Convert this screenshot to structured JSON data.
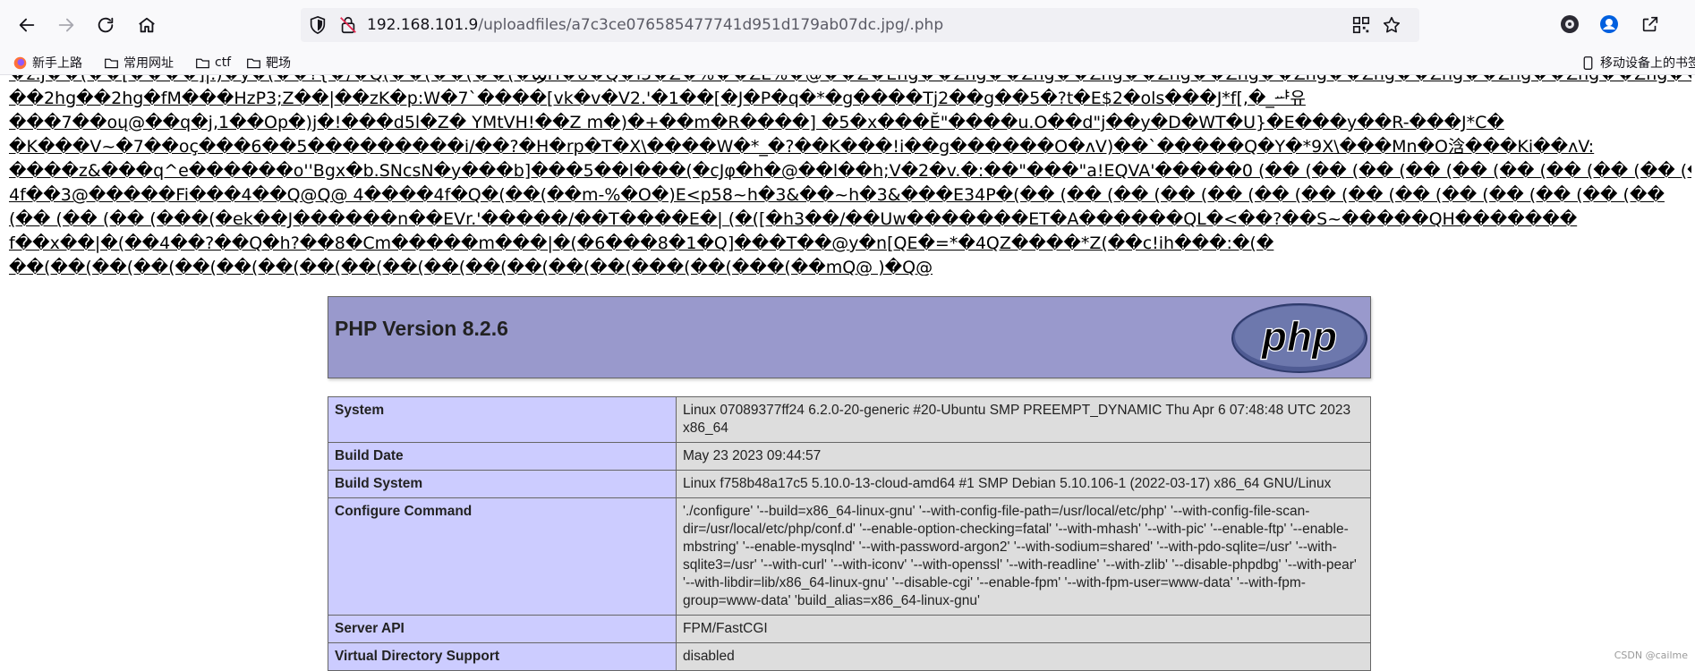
{
  "browser": {
    "url_host": "192.168.101.9",
    "url_path": "/uploadfiles/a7c3ce076585477741d951d179ab07dc.jpg/.php",
    "icons": {
      "back": "arrow-left-icon",
      "forward": "arrow-right-icon",
      "reload": "reload-icon",
      "home": "home-icon",
      "tracking": "shield-icon",
      "insecure": "insecure-lock-icon",
      "qr": "qr-code-icon",
      "bookmark": "star-icon",
      "extension": "extension-icon",
      "account": "account-icon",
      "share": "share-icon"
    }
  },
  "bookmarks": {
    "items": [
      {
        "label": "新手上路",
        "icon": "firefox-icon"
      },
      {
        "label": "常用网址",
        "icon": "folder-icon"
      },
      {
        "label": "ctf",
        "icon": "folder-icon"
      },
      {
        "label": "靶场",
        "icon": "folder-icon"
      }
    ],
    "mobile": "移动设备上的书签"
  },
  "garbage": [
    "�z.j��(��[����]|.)�y�(��?{�/�Q(��(��(��(�ϢH�ö�Q�i5�Z�%��ZE%�@��Z�Eng��Zng��Zng��Zng��Zng��Zng��Zng��Zng��Zng��Zng��Zng��Zng��Zng��Zng��Zng��Zng��Zng",
    "��2hg��2hg�fM���HzP3;Z��|��zK�p:W�7`����[vk�v�V2.'�1��[�J�P�q�*�g����Tj2��g��5�?t�E$2�ols���J*f[,�_ᆄ유",
    "���7��oų@��q�j,1��Op�)j�!���d5l�Z� YMtVH!��Z m�)�+��m�R����] �5�x���Ĕ\"����u.O��d\"j��y�D�WT�U}�E���y��R-���J*C�",
    "�K���V~�7��oç���6��5���������i/��?�H�rp�T�X\\����W�*_�?��K���!i��g������O�ʌV)��`�����Q�Y�*9X\\���Mn�O浛���Ki��ʌV:",
    "����z&���q^e������o''Bgx�b.SNcsN�y���b]���5��l���(�cJφ�h�@��l��h;V�2�v.�:��\"���\"a!EQVA'�����0 (�� (�� (�� (�� (�� (�� (�� (�� (�� (��",
    "4f��3@�����Fi���4��Q@Q@ 4����4f�Q�(��(��m-%�O�)E<p58~h�3&��~h�3&���E34P�(�� (�� (�� (�� (�� (�� (�� (�� (�� (�� (�� (�� (�� (��",
    "(�� (�� (�� (���(�ek��J������n��EVr.'�����/��T����E�| (�([�h3��/��Uw�������ET�A������QL�<��?��S~�����QH�������",
    "f��x��|�(��4��?��Q�h?��8�Cm�����m���|�(�6���8�1�Q]���T��@y�n[QE�=*�4QZ����*Z(��c!ih���:�(�",
    "��(��(��(��(��(��(��(��(��(��(��(��(��(��(��(���(��(���(��mQ@ )�Q@"
  ],
  "php": {
    "title": "PHP Version 8.2.6",
    "logo_text": "php",
    "rows": [
      {
        "key": "System",
        "value": "Linux 07089377ff24 6.2.0-20-generic #20-Ubuntu SMP PREEMPT_DYNAMIC Thu Apr 6 07:48:48 UTC 2023 x86_64"
      },
      {
        "key": "Build Date",
        "value": "May 23 2023 09:44:57"
      },
      {
        "key": "Build System",
        "value": "Linux f758b48a17c5 5.10.0-13-cloud-amd64 #1 SMP Debian 5.10.106-1 (2022-03-17) x86_64 GNU/Linux"
      },
      {
        "key": "Configure Command",
        "value": "'./configure' '--build=x86_64-linux-gnu' '--with-config-file-path=/usr/local/etc/php' '--with-config-file-scan-dir=/usr/local/etc/php/conf.d' '--enable-option-checking=fatal' '--with-mhash' '--with-pic' '--enable-ftp' '--enable-mbstring' '--enable-mysqlnd' '--with-password-argon2' '--with-sodium=shared' '--with-pdo-sqlite=/usr' '--with-sqlite3=/usr' '--with-curl' '--with-iconv' '--with-openssl' '--with-readline' '--with-zlib' '--disable-phpdbg' '--with-pear' '--with-libdir=lib/x86_64-linux-gnu' '--disable-cgi' '--enable-fpm' '--with-fpm-user=www-data' '--with-fpm-group=www-data' 'build_alias=x86_64-linux-gnu'"
      },
      {
        "key": "Server API",
        "value": "FPM/FastCGI"
      },
      {
        "key": "Virtual Directory Support",
        "value": "disabled"
      }
    ]
  },
  "watermark": "CSDN @cailme",
  "colors": {
    "php_header": "#9999cc",
    "key_cell": "#ccccff",
    "value_cell": "#dddddd",
    "toolbar": "#f9f9fb",
    "urlbar": "#f0f0f4"
  }
}
